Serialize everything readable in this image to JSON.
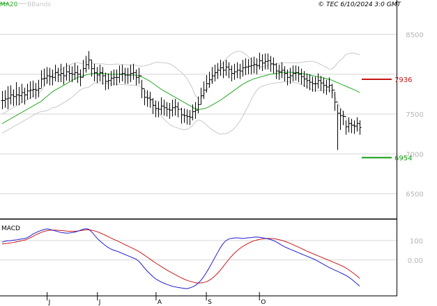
{
  "header": {
    "ma_label": "MA20",
    "bb_label": "BBands",
    "copyright": "© TEC 6/10/2024 3:0 GMT"
  },
  "colors": {
    "price": "#000000",
    "ma": "#22aa22",
    "bbands": "#c8c8c8",
    "grid": "#d6d6d6",
    "macd": "#1e1ecf",
    "signal": "#cc1a1a",
    "resistance": "#c81414",
    "support": "#119911",
    "axis_text": "#b4b4b4",
    "border": "#000000"
  },
  "chart_data": [
    {
      "type": "ohlc",
      "panel": "price",
      "x_tick_labels": [
        "J",
        "J",
        "A",
        "S",
        "O"
      ],
      "y_ticks": [
        6500,
        7000,
        7500,
        8000,
        8500
      ],
      "y_tick_labels": [
        "6500",
        "7000",
        "7500",
        "",
        "8500"
      ],
      "ylim": [
        6200,
        8800
      ],
      "levels": [
        {
          "value": 7936,
          "label": "7936",
          "color": "#c81414"
        },
        {
          "value": 6954,
          "label": "6954",
          "color": "#119911"
        }
      ],
      "close": [
        7670,
        7690,
        7700,
        7740,
        7720,
        7740,
        7730,
        7770,
        7740,
        7790,
        7800,
        7810,
        7800,
        7820,
        7940,
        7950,
        7980,
        7970,
        7960,
        8020,
        7990,
        8010,
        7980,
        8030,
        8010,
        8000,
        8020,
        8000,
        7960,
        8070,
        8120,
        8180,
        8070,
        8020,
        7990,
        8020,
        7980,
        7910,
        7920,
        7950,
        7960,
        7960,
        8000,
        8010,
        7990,
        7990,
        8010,
        8020,
        7960,
        7980,
        7820,
        7710,
        7700,
        7680,
        7610,
        7570,
        7560,
        7600,
        7580,
        7560,
        7550,
        7580,
        7590,
        7560,
        7490,
        7480,
        7470,
        7460,
        7530,
        7550,
        7620,
        7730,
        7800,
        7880,
        7930,
        7980,
        8020,
        8050,
        8080,
        8050,
        8090,
        8060,
        8010,
        8030,
        8050,
        8040,
        8080,
        8090,
        8100,
        8110,
        8120,
        8110,
        8170,
        8140,
        8160,
        8170,
        8130,
        8120,
        8040,
        8030,
        8050,
        8010,
        7960,
        7980,
        8010,
        8020,
        8000,
        7970,
        7940,
        7920,
        7900,
        7880,
        7880,
        7920,
        7890,
        7860,
        7840,
        7860,
        7800,
        7650,
        7510,
        7480,
        7470,
        7340,
        7380,
        7360,
        7350,
        7380,
        7330
      ],
      "high": [
        7790,
        7800,
        7850,
        7860,
        7810,
        7900,
        7840,
        7880,
        7830,
        7880,
        7910,
        7920,
        7890,
        7930,
        8050,
        8070,
        8090,
        8080,
        8060,
        8120,
        8080,
        8130,
        8090,
        8140,
        8110,
        8100,
        8140,
        8110,
        8060,
        8180,
        8230,
        8290,
        8180,
        8130,
        8090,
        8120,
        8090,
        8020,
        8010,
        8040,
        8060,
        8060,
        8110,
        8120,
        8080,
        8080,
        8120,
        8130,
        8060,
        8080,
        7930,
        7810,
        7800,
        7780,
        7700,
        7670,
        7660,
        7710,
        7680,
        7650,
        7640,
        7680,
        7690,
        7650,
        7580,
        7570,
        7560,
        7550,
        7620,
        7650,
        7720,
        7830,
        7910,
        7990,
        8030,
        8090,
        8120,
        8140,
        8180,
        8160,
        8180,
        8150,
        8110,
        8130,
        8150,
        8130,
        8180,
        8200,
        8190,
        8210,
        8220,
        8200,
        8270,
        8250,
        8260,
        8260,
        8230,
        8210,
        8140,
        8120,
        8150,
        8100,
        8060,
        8080,
        8110,
        8110,
        8100,
        8070,
        8040,
        8010,
        8000,
        7970,
        7970,
        8010,
        7980,
        7960,
        7930,
        7960,
        7880,
        7780,
        7620,
        7570,
        7540,
        7420,
        7460,
        7440,
        7420,
        7460,
        7420
      ],
      "low": [
        7560,
        7580,
        7560,
        7620,
        7600,
        7610,
        7610,
        7640,
        7620,
        7680,
        7690,
        7710,
        7690,
        7710,
        7830,
        7850,
        7880,
        7860,
        7860,
        7910,
        7900,
        7900,
        7870,
        7920,
        7910,
        7900,
        7930,
        7890,
        7850,
        7960,
        8020,
        8060,
        7970,
        7910,
        7890,
        7910,
        7870,
        7800,
        7810,
        7850,
        7860,
        7860,
        7890,
        7910,
        7880,
        7880,
        7900,
        7930,
        7860,
        7880,
        7700,
        7610,
        7590,
        7580,
        7500,
        7460,
        7460,
        7490,
        7480,
        7470,
        7440,
        7470,
        7480,
        7460,
        7380,
        7390,
        7370,
        7360,
        7420,
        7440,
        7510,
        7620,
        7690,
        7770,
        7830,
        7880,
        7910,
        7940,
        7980,
        7950,
        7980,
        7950,
        7910,
        7930,
        7950,
        7940,
        7970,
        7990,
        8000,
        8000,
        8010,
        8000,
        8060,
        8040,
        8060,
        8060,
        8030,
        8010,
        7940,
        7930,
        7950,
        7910,
        7860,
        7880,
        7910,
        7920,
        7900,
        7870,
        7840,
        7820,
        7800,
        7780,
        7780,
        7820,
        7790,
        7760,
        7740,
        7770,
        7700,
        7540,
        7050,
        7300,
        7360,
        7240,
        7270,
        7260,
        7250,
        7280,
        7240
      ],
      "ma20": [
        7380,
        7400,
        7420,
        7440,
        7460,
        7480,
        7500,
        7520,
        7540,
        7560,
        7580,
        7600,
        7620,
        7640,
        7660,
        7690,
        7720,
        7750,
        7780,
        7800,
        7820,
        7840,
        7860,
        7880,
        7900,
        7920,
        7940,
        7960,
        7970,
        7980,
        7990,
        8000,
        8005,
        8010,
        8010,
        8010,
        8010,
        8005,
        8000,
        8000,
        8000,
        8000,
        8000,
        7995,
        7995,
        7990,
        7990,
        7990,
        7985,
        7980,
        7965,
        7950,
        7930,
        7910,
        7885,
        7860,
        7835,
        7810,
        7790,
        7770,
        7750,
        7730,
        7710,
        7690,
        7670,
        7650,
        7630,
        7610,
        7590,
        7570,
        7560,
        7560,
        7565,
        7575,
        7590,
        7610,
        7630,
        7650,
        7670,
        7695,
        7720,
        7745,
        7770,
        7795,
        7820,
        7845,
        7870,
        7890,
        7910,
        7925,
        7940,
        7950,
        7960,
        7970,
        7980,
        7990,
        8000,
        8005,
        8010,
        8015,
        8020,
        8025,
        8025,
        8025,
        8022,
        8018,
        8014,
        8010,
        8005,
        8000,
        7992,
        7984,
        7976,
        7968,
        7960,
        7952,
        7944,
        7935,
        7925,
        7910,
        7895,
        7880,
        7865,
        7850,
        7835,
        7820,
        7805,
        7790,
        7770
      ]
    },
    {
      "type": "line",
      "panel": "macd",
      "title": "MACD",
      "y_ticks": [
        100,
        0
      ],
      "y_tick_labels": [
        "100",
        "0.00"
      ],
      "ylim": [
        -180,
        200
      ],
      "macd": [
        92,
        96,
        99,
        99,
        102,
        103,
        106,
        108,
        110,
        115,
        123,
        133,
        140,
        147,
        152,
        157,
        160,
        158,
        154,
        150,
        146,
        142,
        140,
        138,
        139,
        141,
        143,
        148,
        153,
        158,
        162,
        158,
        146,
        129,
        112,
        98,
        86,
        74,
        64,
        56,
        50,
        46,
        40,
        34,
        28,
        22,
        16,
        10,
        4,
        -8,
        -24,
        -42,
        -58,
        -72,
        -86,
        -98,
        -106,
        -114,
        -120,
        -126,
        -131,
        -136,
        -139,
        -142,
        -144,
        -146,
        -148,
        -145,
        -140,
        -133,
        -122,
        -108,
        -90,
        -68,
        -44,
        -18,
        8,
        34,
        60,
        82,
        98,
        107,
        111,
        113,
        114,
        113,
        111,
        112,
        114,
        115,
        117,
        118,
        117,
        115,
        112,
        109,
        106,
        101,
        94,
        86,
        77,
        69,
        62,
        56,
        50,
        44,
        38,
        32,
        26,
        20,
        14,
        8,
        2,
        -6,
        -14,
        -22,
        -30,
        -38,
        -45,
        -52,
        -58,
        -65,
        -72,
        -79,
        -88,
        -98,
        -110,
        -122,
        -135
      ],
      "signal": [
        82,
        84,
        86,
        88,
        90,
        93,
        96,
        99,
        102,
        107,
        114,
        121,
        129,
        136,
        142,
        147,
        151,
        153,
        154,
        154,
        153,
        152,
        151,
        149,
        148,
        148,
        148,
        149,
        151,
        153,
        155,
        155,
        154,
        150,
        146,
        140,
        134,
        127,
        120,
        113,
        106,
        100,
        93,
        86,
        79,
        72,
        65,
        58,
        51,
        43,
        34,
        24,
        14,
        4,
        -6,
        -16,
        -25,
        -34,
        -43,
        -52,
        -60,
        -68,
        -76,
        -84,
        -91,
        -98,
        -104,
        -109,
        -113,
        -117,
        -119,
        -119,
        -117,
        -113,
        -106,
        -97,
        -85,
        -71,
        -55,
        -37,
        -18,
        0,
        17,
        32,
        46,
        58,
        68,
        77,
        85,
        92,
        98,
        102,
        106,
        108,
        110,
        111,
        111,
        110,
        108,
        105,
        101,
        97,
        92,
        86,
        80,
        73,
        67,
        60,
        53,
        46,
        40,
        34,
        28,
        22,
        16,
        10,
        4,
        -2,
        -8,
        -14,
        -20,
        -26,
        -33,
        -41,
        -50,
        -60,
        -71,
        -82,
        -95
      ]
    }
  ]
}
